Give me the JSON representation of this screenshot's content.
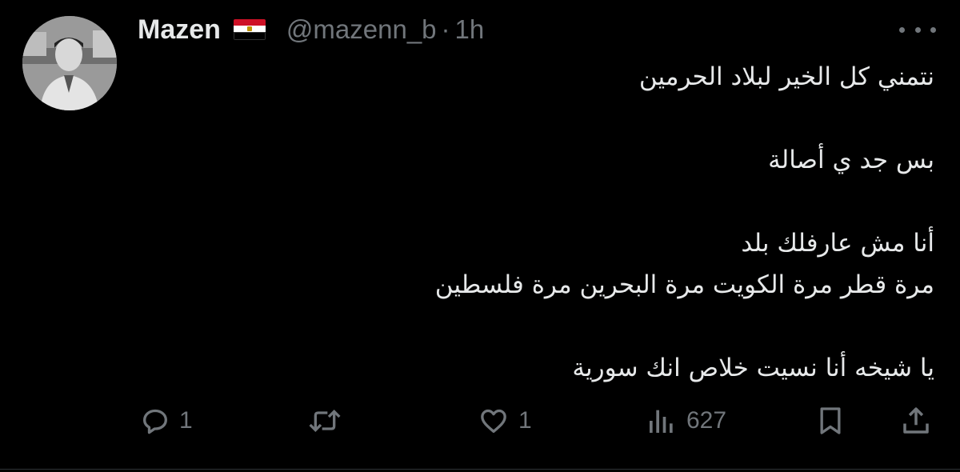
{
  "author": {
    "name": "Mazen",
    "flag": "egypt-flag",
    "handle": "@mazenn_b",
    "separator": "·",
    "time": "1h"
  },
  "tweet": {
    "lines": [
      "نتمني كل الخير لبلاد الحرمين",
      "",
      "بس جد ي أصالة",
      "",
      "أنا مش عارفلك بلد",
      "مرة قطر مرة الكويت مرة البحرين مرة فلسطين",
      "",
      "يا شيخه أنا نسيت خلاص انك سورية"
    ]
  },
  "actions": {
    "reply": {
      "icon": "reply-icon",
      "count": "1"
    },
    "retweet": {
      "icon": "retweet-icon",
      "count": ""
    },
    "like": {
      "icon": "heart-icon",
      "count": "1"
    },
    "views": {
      "icon": "analytics-icon",
      "count": "627"
    },
    "bookmark": {
      "icon": "bookmark-icon"
    },
    "share": {
      "icon": "share-icon"
    }
  },
  "colors": {
    "background": "#000000",
    "text": "#e7e9ea",
    "muted": "#71767b"
  }
}
